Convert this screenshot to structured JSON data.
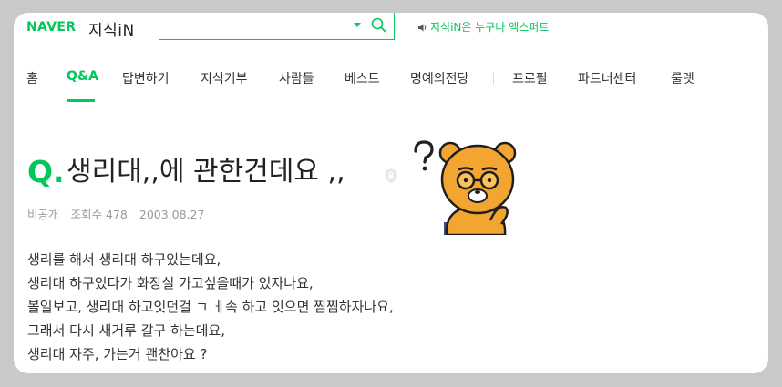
{
  "header": {
    "logo_naver": "NAVER",
    "logo_kin": "지식iN",
    "search": {
      "value": "",
      "placeholder": ""
    },
    "notice": "지식iN은 누구나 엑스퍼트",
    "accent_color": "#03c75a"
  },
  "nav": {
    "items": [
      {
        "label": "홈"
      },
      {
        "label": "Q&A"
      },
      {
        "label": "답변하기"
      },
      {
        "label": "지식기부"
      },
      {
        "label": "사람들"
      },
      {
        "label": "베스트"
      },
      {
        "label": "명예의전당"
      },
      {
        "label": "프로필"
      },
      {
        "label": "파트너센터"
      },
      {
        "label": "룰렛"
      }
    ],
    "active": "Q&A"
  },
  "question": {
    "q_mark": "Q.",
    "title": "생리대,,에 관한건데요 ,,",
    "author": "비공개",
    "views_label": "조회수",
    "views": "478",
    "date": "2003.08.27",
    "body_lines": [
      "생리를 해서 생리대 하구있는데요,",
      "생리대 하구있다가 화장실 가고싶을때가 있자나요,",
      "볼일보고, 생리대 하고잇던걸 ㄱ ㅔ속 하고 잇으면 찜찜하자나요,",
      "그래서 다시 새거루 갈구 하는데요,",
      "생리대 자주, 가는거 괜찬아요 ?"
    ]
  },
  "icons": [
    "search-icon",
    "dropdown-caret-icon",
    "speaker-icon",
    "lock-icon",
    "mascot-thinking-image"
  ]
}
